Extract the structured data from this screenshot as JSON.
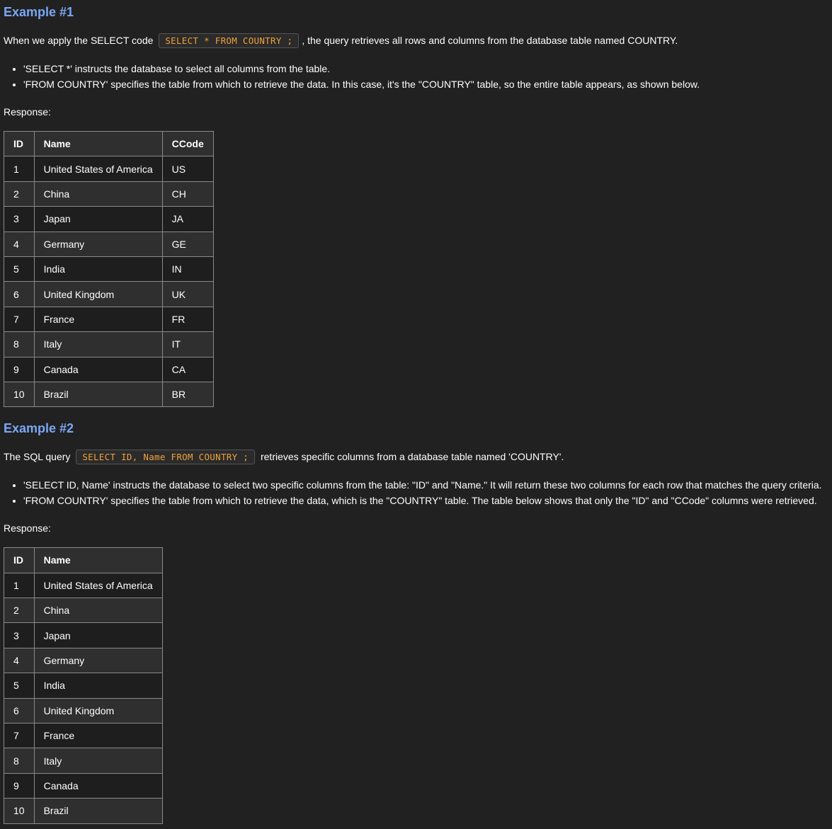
{
  "example1": {
    "heading": "Example #1",
    "intro_before": "When we apply the SELECT code",
    "code": "SELECT * FROM COUNTRY ;",
    "intro_after": ", the query retrieves all rows and columns from the database table named COUNTRY.",
    "bullets": [
      "'SELECT *' instructs the database to select all columns from the table.",
      "'FROM COUNTRY' specifies the table from which to retrieve the data. In this case, it's the \"COUNTRY\" table, so the entire table appears, as shown below."
    ],
    "response_label": "Response:",
    "table": {
      "headers": [
        "ID",
        "Name",
        "CCode"
      ],
      "rows": [
        [
          "1",
          "United States of America",
          "US"
        ],
        [
          "2",
          "China",
          "CH"
        ],
        [
          "3",
          "Japan",
          "JA"
        ],
        [
          "4",
          "Germany",
          "GE"
        ],
        [
          "5",
          "India",
          "IN"
        ],
        [
          "6",
          "United Kingdom",
          "UK"
        ],
        [
          "7",
          "France",
          "FR"
        ],
        [
          "8",
          "Italy",
          "IT"
        ],
        [
          "9",
          "Canada",
          "CA"
        ],
        [
          "10",
          "Brazil",
          "BR"
        ]
      ]
    }
  },
  "example2": {
    "heading": "Example #2",
    "intro_before": "The SQL query",
    "code": "SELECT ID, Name FROM COUNTRY ;",
    "intro_after": "retrieves specific columns from a database table named 'COUNTRY'.",
    "bullets": [
      "'SELECT ID, Name' instructs the database to select two specific columns from the table: \"ID\" and \"Name.\" It will return these two columns for each row that matches the query criteria.",
      "'FROM COUNTRY' specifies the table from which to retrieve the data, which is the \"COUNTRY\" table. The table below shows that only the \"ID\" and \"CCode\" columns were retrieved."
    ],
    "response_label": "Response:",
    "table": {
      "headers": [
        "ID",
        "Name"
      ],
      "rows": [
        [
          "1",
          "United States of America"
        ],
        [
          "2",
          "China"
        ],
        [
          "3",
          "Japan"
        ],
        [
          "4",
          "Germany"
        ],
        [
          "5",
          "India"
        ],
        [
          "6",
          "United Kingdom"
        ],
        [
          "7",
          "France"
        ],
        [
          "8",
          "Italy"
        ],
        [
          "9",
          "Canada"
        ],
        [
          "10",
          "Brazil"
        ]
      ]
    }
  }
}
